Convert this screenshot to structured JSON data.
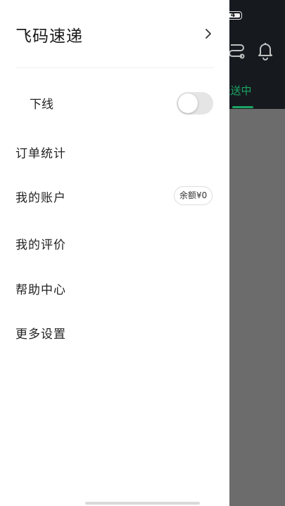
{
  "status_bar": {
    "battery_level": "4"
  },
  "background": {
    "active_tab": "派送中",
    "icons": [
      "route-icon",
      "bell-icon"
    ],
    "accent_color": "#1aa563"
  },
  "drawer": {
    "title": "飞码速递",
    "status": {
      "label": "下线",
      "toggle_on": false
    },
    "menu": [
      {
        "label": "订单统计"
      },
      {
        "label": "我的账户",
        "badge": "余额¥0"
      },
      {
        "label": "我的评价"
      },
      {
        "label": "帮助中心"
      },
      {
        "label": "更多设置"
      }
    ]
  }
}
